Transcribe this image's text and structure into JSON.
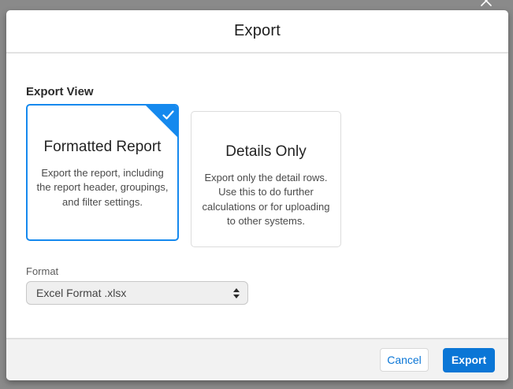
{
  "dialog": {
    "title": "Export"
  },
  "export_view": {
    "heading": "Export View",
    "options": [
      {
        "title": "Formatted Report",
        "description": "Export the report, including\nthe report header, groupings,\nand filter settings.",
        "selected": true
      },
      {
        "title": "Details Only",
        "description": "Export only the detail rows.\nUse this to do further\ncalculations or for uploading\nto other systems.",
        "selected": false
      }
    ]
  },
  "format": {
    "label": "Format",
    "value": "Excel Format .xlsx"
  },
  "footer": {
    "cancel_label": "Cancel",
    "export_label": "Export"
  },
  "icons": {
    "close": "x-icon",
    "selected_check": "check-icon",
    "select_spinner": "up-down-arrows-icon"
  },
  "colors": {
    "selected_card_border": "#1589ee",
    "primary_button": "#0b76d6",
    "overlay": "#8a8a8a",
    "footer_background": "#f2f2f2"
  }
}
